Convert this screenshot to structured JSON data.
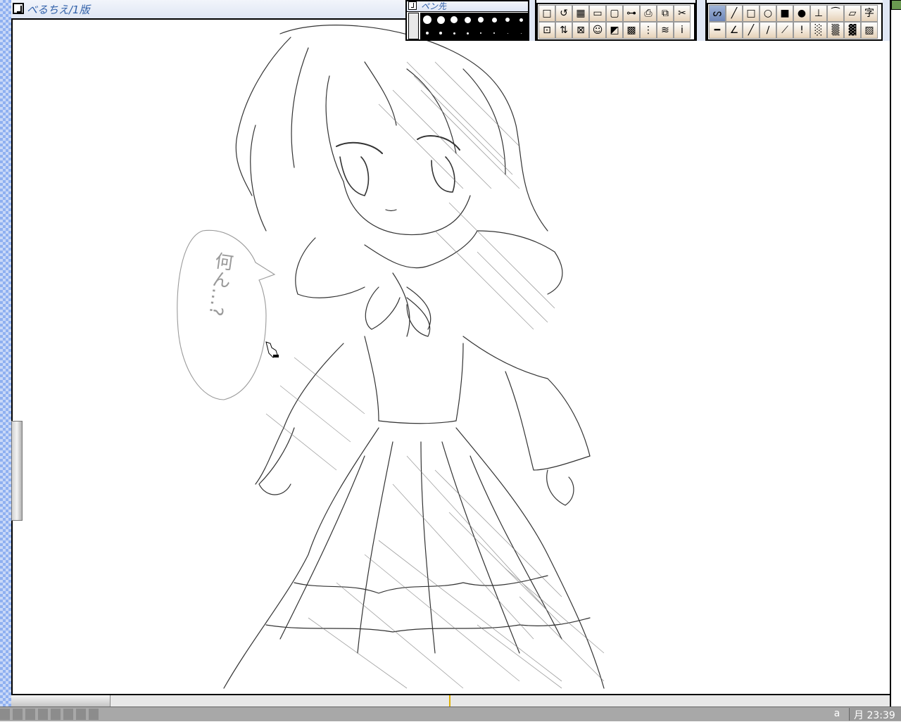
{
  "window": {
    "title": "べるちえ/1版"
  },
  "pen_palette": {
    "title": "ペン先",
    "sizes_row1": [
      12,
      11,
      10,
      9,
      8,
      7,
      6,
      5
    ],
    "sizes_row2": [
      4,
      4,
      3,
      3,
      2,
      2,
      1,
      1
    ]
  },
  "tools_palette": {
    "row1": [
      "□",
      "↺",
      "▦",
      "▭",
      "▢",
      "⊶",
      "⎙",
      "⧉",
      "✂"
    ],
    "row2": [
      "⊡",
      "⇅",
      "⊠",
      "☺",
      "◩",
      "▩",
      "⋮",
      "≋",
      "i"
    ]
  },
  "draw_palette": {
    "row1": [
      "ᔕ",
      "╱",
      "□",
      "○",
      "■",
      "●",
      "⊥",
      "⁀",
      "▱",
      "字"
    ],
    "row2": [
      "━",
      "∠",
      "╱",
      "∕",
      "⟋",
      "!",
      "░",
      "▒",
      "▓",
      "▨"
    ]
  },
  "canvas": {
    "speech_text": "何ん…?"
  },
  "taskbar": {
    "input_mode": "a",
    "clock": "月 23:39"
  }
}
